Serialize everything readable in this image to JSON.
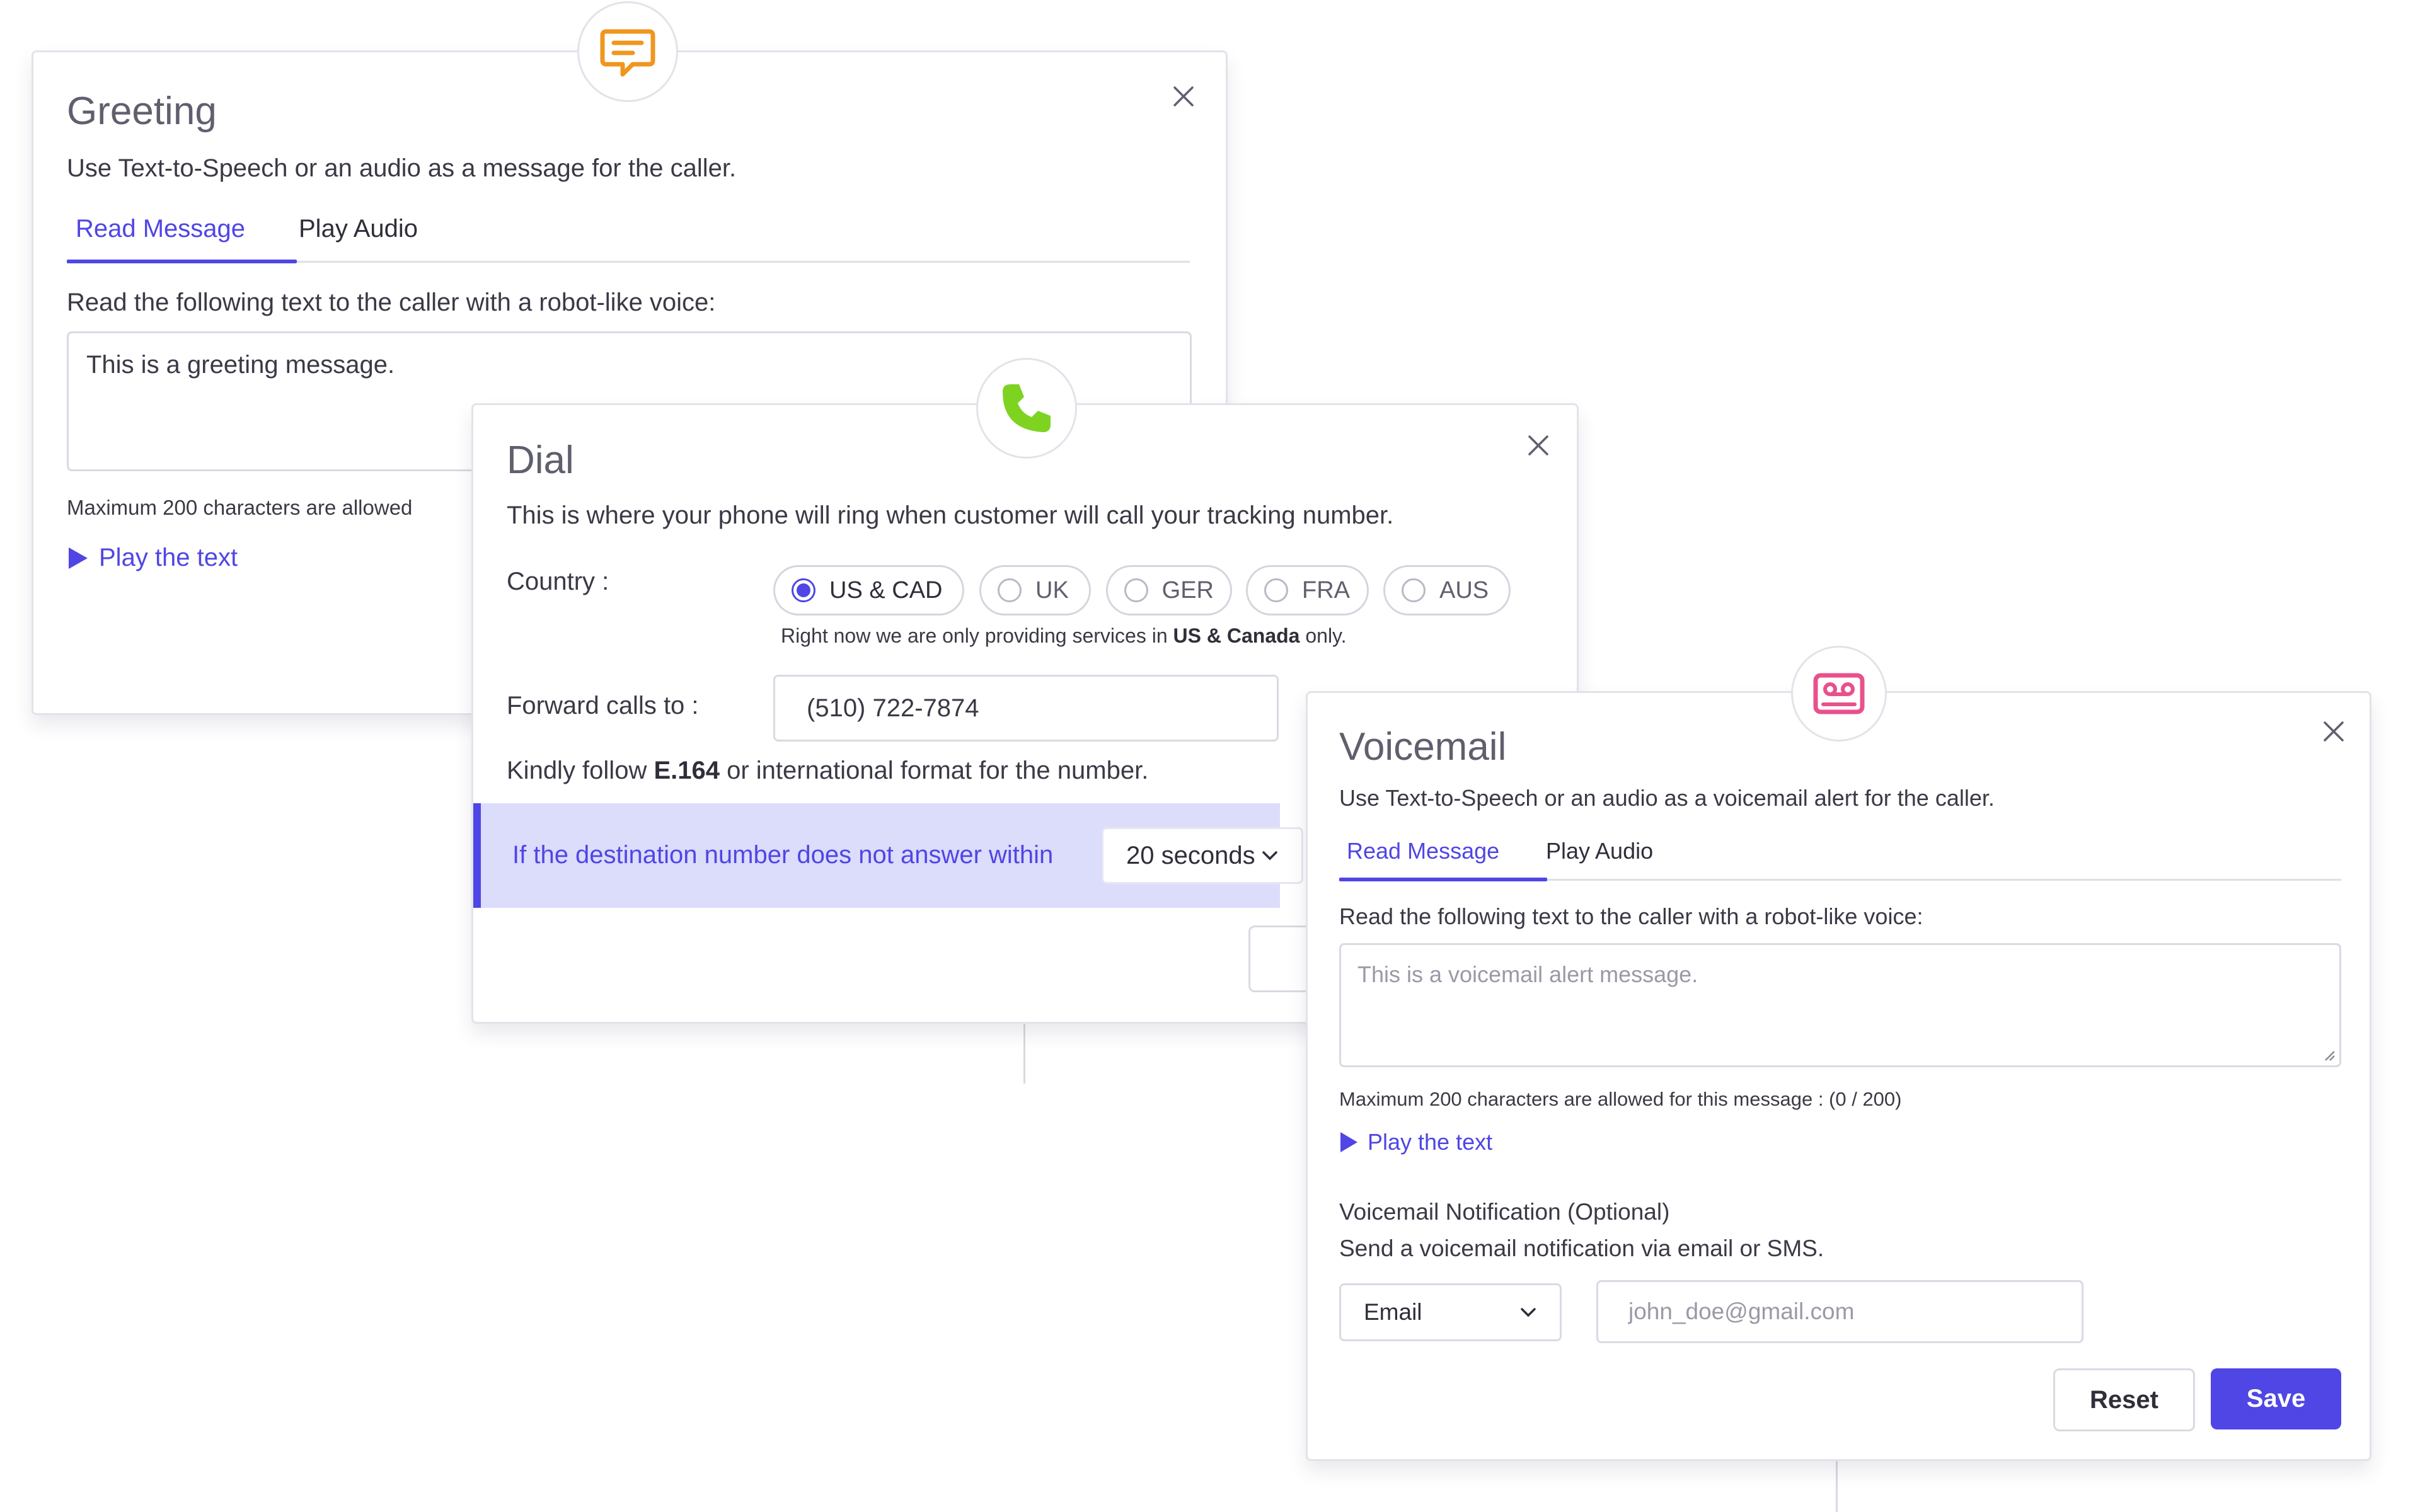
{
  "greeting": {
    "title": "Greeting",
    "subtitle": "Use Text-to-Speech or an audio as a message for the caller.",
    "tabs": [
      {
        "label": "Read Message",
        "active": true
      },
      {
        "label": "Play Audio",
        "active": false
      }
    ],
    "instruction": "Read the following text to the caller with a robot-like voice:",
    "message": "This is a greeting message.",
    "char_limit": "Maximum 200 characters are allowed",
    "play_label": "Play the text",
    "icon": "chat-bubble-icon",
    "accent": "#f0961e"
  },
  "dial": {
    "title": "Dial",
    "subtitle": "This is where your phone will ring when customer will call your tracking number.",
    "country_label": "Country :",
    "countries": [
      {
        "label": "US & CAD",
        "selected": true
      },
      {
        "label": "UK",
        "selected": false
      },
      {
        "label": "GER",
        "selected": false
      },
      {
        "label": "FRA",
        "selected": false
      },
      {
        "label": "AUS",
        "selected": false
      }
    ],
    "service_note_prefix": "Right now we are only providing services in ",
    "service_note_bold": "US & Canada",
    "service_note_suffix": " only.",
    "forward_label": "Forward calls to :",
    "forward_value": "(510) 722-7874",
    "format_prefix": "Kindly follow ",
    "format_bold": "E.164",
    "format_suffix": " or international format for the number.",
    "timeout_text": "If the destination number does not answer within",
    "timeout_value": "20 seconds",
    "icon": "phone-icon",
    "accent": "#7ed321"
  },
  "voicemail": {
    "title": "Voicemail",
    "subtitle": "Use Text-to-Speech or an audio as a voicemail alert for the caller.",
    "tabs": [
      {
        "label": "Read Message",
        "active": true
      },
      {
        "label": "Play Audio",
        "active": false
      }
    ],
    "instruction": "Read the following text to the caller with a robot-like voice:",
    "message_placeholder": "This is a voicemail alert message.",
    "char_limit": "Maximum 200 characters are allowed for this message : (0 / 200)",
    "play_label": "Play the text",
    "notification_title": "Voicemail Notification (Optional)",
    "notification_desc": "Send a voicemail notification via email or SMS.",
    "channel_value": "Email",
    "email_placeholder": "john_doe@gmail.com",
    "reset_label": "Reset",
    "save_label": "Save",
    "icon": "voicemail-icon",
    "accent": "#e8518c"
  },
  "colors": {
    "primary": "#4f46e5",
    "banner_bg": "#dcdcfb"
  }
}
